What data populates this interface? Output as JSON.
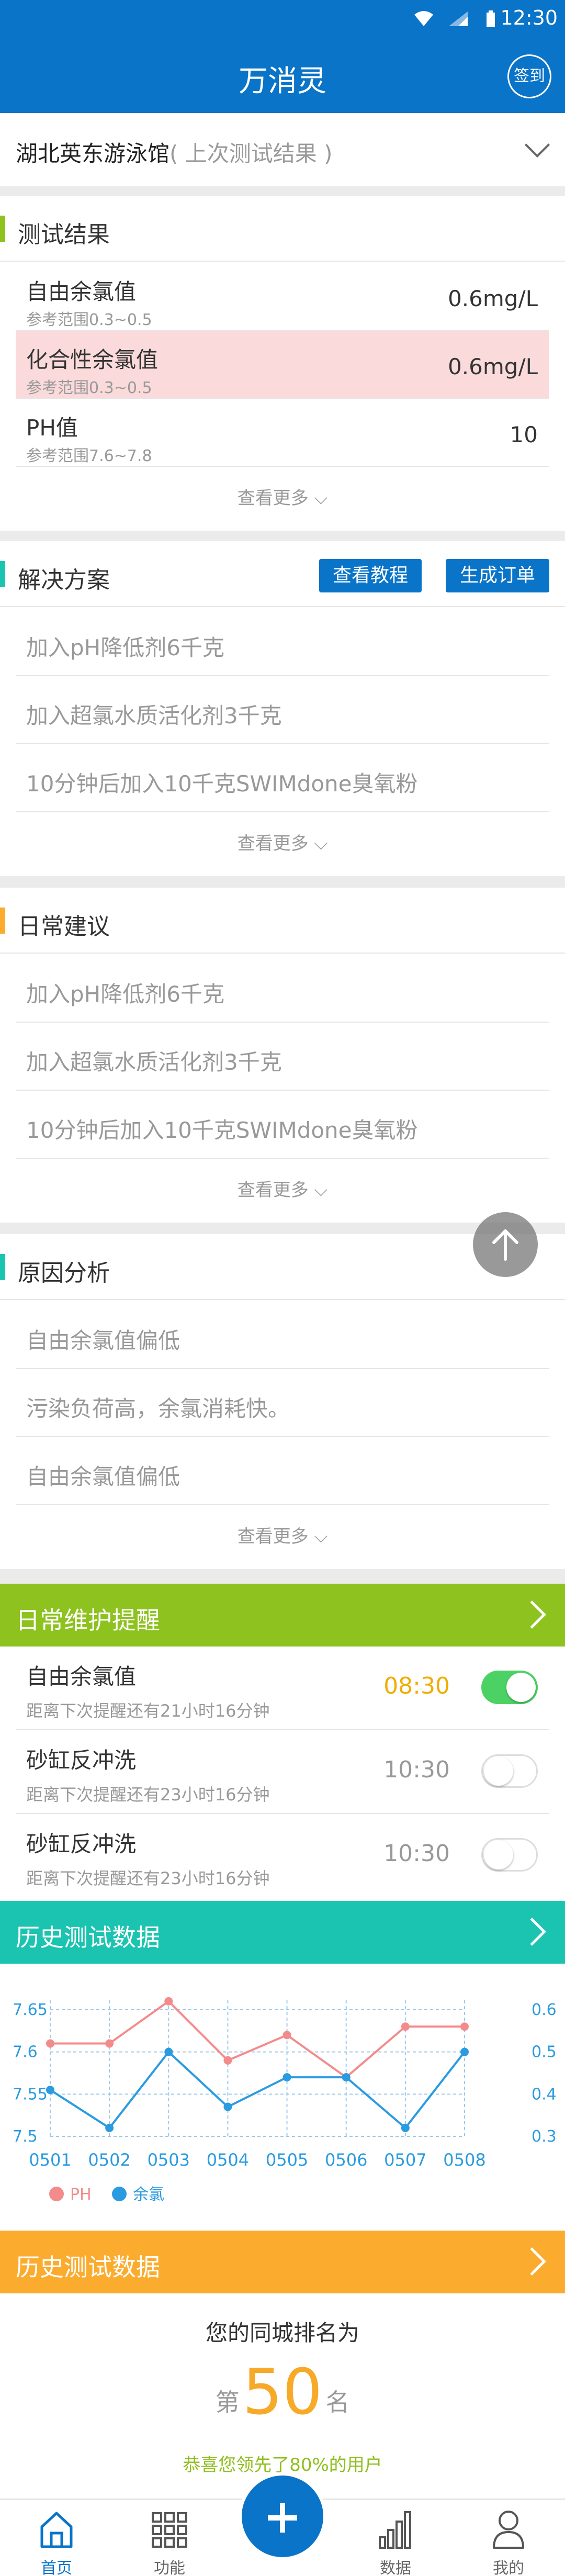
{
  "status": {
    "time": "12:30"
  },
  "header": {
    "title": "万消灵",
    "signin": "签到"
  },
  "pool": {
    "name": "湖北英东游泳馆",
    "hint": "( 上次测试结果 )"
  },
  "test_results": {
    "title": "测试结果",
    "rows": [
      {
        "name": "自由余氯值",
        "range": "参考范围0.3~0.5",
        "value": "0.6mg/L",
        "highlight": false
      },
      {
        "name": "化合性余氯值",
        "range": "参考范围0.3~0.5",
        "value": "0.6mg/L",
        "highlight": true
      },
      {
        "name": "PH值",
        "range": "参考范围7.6~7.8",
        "value": "10",
        "highlight": false
      }
    ],
    "more": "查看更多"
  },
  "solutions": {
    "title": "解决方案",
    "btn_tutorial": "查看教程",
    "btn_order": "生成订单",
    "items": [
      "加入pH降低剂6千克",
      "加入超氯水质活化剂3千克",
      "10分钟后加入10千克SWIMdone臭氧粉"
    ],
    "more": "查看更多"
  },
  "daily_advice": {
    "title": "日常建议",
    "items": [
      "加入pH降低剂6千克",
      "加入超氯水质活化剂3千克",
      "10分钟后加入10千克SWIMdone臭氧粉"
    ],
    "more": "查看更多"
  },
  "causes": {
    "title": "原因分析",
    "items": [
      "自由余氯值偏低",
      "污染负荷高，余氯消耗快。",
      "自由余氯值偏低"
    ],
    "more": "查看更多"
  },
  "maintenance": {
    "title": "日常维护提醒",
    "items": [
      {
        "name": "自由余氯值",
        "desc": "距离下次提醒还有21小时16分钟",
        "time": "08:30",
        "on": true
      },
      {
        "name": "砂缸反冲洗",
        "desc": "距离下次提醒还有23小时16分钟",
        "time": "10:30",
        "on": false
      },
      {
        "name": "砂缸反冲洗",
        "desc": "距离下次提醒还有23小时16分钟",
        "time": "10:30",
        "on": false
      }
    ]
  },
  "history": {
    "title": "历史测试数据"
  },
  "chart_data": {
    "type": "line",
    "categories": [
      "0501",
      "0502",
      "0503",
      "0504",
      "0505",
      "0506",
      "0507",
      "0508"
    ],
    "series": [
      {
        "name": "PH",
        "axis": "left",
        "color": "#f48b8b",
        "values": [
          7.61,
          7.61,
          7.66,
          7.59,
          7.62,
          7.57,
          7.63,
          7.63
        ]
      },
      {
        "name": "余氯",
        "axis": "right",
        "color": "#2a9be0",
        "values": [
          0.41,
          0.32,
          0.5,
          0.37,
          0.44,
          0.44,
          0.32,
          0.5
        ]
      }
    ],
    "y_left": {
      "ticks": [
        "7.65",
        "7.6",
        "7.55",
        "7.5"
      ],
      "range": [
        7.5,
        7.66
      ]
    },
    "y_right": {
      "ticks": [
        "0.6",
        "0.5",
        "0.4",
        "0.3"
      ],
      "range": [
        0.3,
        0.62
      ]
    },
    "legend": [
      "PH",
      "余氯"
    ],
    "legend_position": "bottom-left"
  },
  "ranking": {
    "title": "历史测试数据",
    "line1": "您的同城排名为",
    "prefix": "第",
    "rank": "50",
    "suffix": "名",
    "line3": "恭喜您领先了80%的用户"
  },
  "tabs": [
    {
      "label": "首页",
      "icon": "home-icon",
      "active": true
    },
    {
      "label": "功能",
      "icon": "grid-icon",
      "active": false
    },
    {
      "label": "数据",
      "icon": "bars-icon",
      "active": false
    },
    {
      "label": "我的",
      "icon": "user-icon",
      "active": false
    }
  ],
  "colors": {
    "primary": "#0a74c9",
    "accent_green": "#8dc21f",
    "teal": "#1bc4b0",
    "orange": "#fbac2f",
    "highlight_pink": "#fadadb"
  }
}
